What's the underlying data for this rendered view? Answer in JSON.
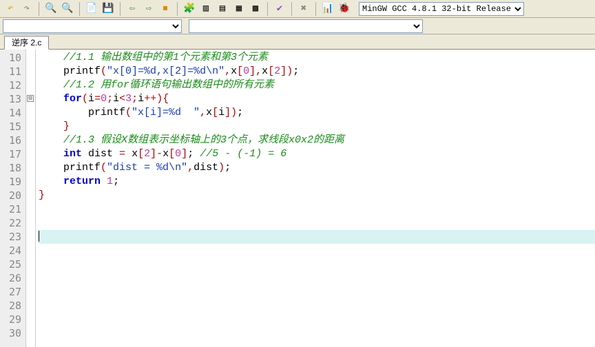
{
  "toolbar": {
    "undo_icon": "↶",
    "redo_icon": "↷",
    "search_icon": "🔍",
    "searchrep_icon": "🔍",
    "open_icon": "📄",
    "save_icon": "💾",
    "back_icon": "⇦",
    "fwd_icon": "⇨",
    "abort_icon": "⏹",
    "a_icon": "🧩",
    "b_icon": "▥",
    "c_icon": "▤",
    "d_icon": "▦",
    "e_icon": "▩",
    "check_icon": "✔",
    "x_icon": "✖",
    "chart_icon": "📊",
    "bug_icon": "🐞",
    "target_select": "MinGW GCC 4.8.1 32-bit Release"
  },
  "tab": {
    "label": "逆序 2.c"
  },
  "gutter": {
    "start": 10,
    "end": 30
  },
  "fold": {
    "line": 13,
    "glyph": "⊟"
  },
  "code": [
    {
      "indent": 4,
      "spans": [
        {
          "cls": "c-comment",
          "t": "//1.1 输出数组中的第1个元素和第3个元素"
        }
      ]
    },
    {
      "indent": 4,
      "spans": [
        {
          "cls": "c-func",
          "t": "printf"
        },
        {
          "cls": "c-op",
          "t": "("
        },
        {
          "cls": "c-str",
          "t": "\"x[0]=%d,x[2]=%d\\n\""
        },
        {
          "cls": "c-op",
          "t": ","
        },
        {
          "cls": "c-id",
          "t": "x"
        },
        {
          "cls": "c-op",
          "t": "["
        },
        {
          "cls": "c-num",
          "t": "0"
        },
        {
          "cls": "c-op",
          "t": "]"
        },
        {
          "cls": "c-op",
          "t": ","
        },
        {
          "cls": "c-id",
          "t": "x"
        },
        {
          "cls": "c-op",
          "t": "["
        },
        {
          "cls": "c-num",
          "t": "2"
        },
        {
          "cls": "c-op",
          "t": "]"
        },
        {
          "cls": "c-op",
          "t": ")"
        },
        {
          "cls": "c-punc",
          "t": ";"
        }
      ]
    },
    {
      "indent": 4,
      "spans": [
        {
          "cls": "c-comment",
          "t": "//1.2 用for循环语句输出数组中的所有元素"
        }
      ]
    },
    {
      "indent": 4,
      "spans": [
        {
          "cls": "c-kw",
          "t": "for"
        },
        {
          "cls": "c-op",
          "t": "("
        },
        {
          "cls": "c-id",
          "t": "i"
        },
        {
          "cls": "c-op",
          "t": "="
        },
        {
          "cls": "c-num",
          "t": "0"
        },
        {
          "cls": "c-op",
          "t": ";"
        },
        {
          "cls": "c-id",
          "t": "i"
        },
        {
          "cls": "c-op",
          "t": "<"
        },
        {
          "cls": "c-num",
          "t": "3"
        },
        {
          "cls": "c-op",
          "t": ";"
        },
        {
          "cls": "c-id",
          "t": "i"
        },
        {
          "cls": "c-op",
          "t": "++"
        },
        {
          "cls": "c-op",
          "t": ")"
        },
        {
          "cls": "c-op",
          "t": "{"
        }
      ]
    },
    {
      "indent": 8,
      "spans": [
        {
          "cls": "c-func",
          "t": "printf"
        },
        {
          "cls": "c-op",
          "t": "("
        },
        {
          "cls": "c-str",
          "t": "\"x[i]=%d  \""
        },
        {
          "cls": "c-op",
          "t": ","
        },
        {
          "cls": "c-id",
          "t": "x"
        },
        {
          "cls": "c-op",
          "t": "["
        },
        {
          "cls": "c-id",
          "t": "i"
        },
        {
          "cls": "c-op",
          "t": "]"
        },
        {
          "cls": "c-op",
          "t": ")"
        },
        {
          "cls": "c-punc",
          "t": ";"
        }
      ]
    },
    {
      "indent": 4,
      "spans": [
        {
          "cls": "c-op",
          "t": "}"
        }
      ]
    },
    {
      "indent": 4,
      "spans": [
        {
          "cls": "c-comment",
          "t": "//1.3 假设X数组表示坐标轴上的3个点，求线段x0x2的距离"
        }
      ]
    },
    {
      "indent": 4,
      "spans": [
        {
          "cls": "c-kw",
          "t": "int"
        },
        {
          "cls": "c-id",
          "t": " dist "
        },
        {
          "cls": "c-op",
          "t": "="
        },
        {
          "cls": "c-id",
          "t": " x"
        },
        {
          "cls": "c-op",
          "t": "["
        },
        {
          "cls": "c-num",
          "t": "2"
        },
        {
          "cls": "c-op",
          "t": "]"
        },
        {
          "cls": "c-op",
          "t": "-"
        },
        {
          "cls": "c-id",
          "t": "x"
        },
        {
          "cls": "c-op",
          "t": "["
        },
        {
          "cls": "c-num",
          "t": "0"
        },
        {
          "cls": "c-op",
          "t": "]"
        },
        {
          "cls": "c-punc",
          "t": "; "
        },
        {
          "cls": "c-comment",
          "t": "//5 - (-1) = 6"
        }
      ]
    },
    {
      "indent": 4,
      "spans": [
        {
          "cls": "c-func",
          "t": "printf"
        },
        {
          "cls": "c-op",
          "t": "("
        },
        {
          "cls": "c-str",
          "t": "\"dist = %d\\n\""
        },
        {
          "cls": "c-op",
          "t": ","
        },
        {
          "cls": "c-id",
          "t": "dist"
        },
        {
          "cls": "c-op",
          "t": ")"
        },
        {
          "cls": "c-punc",
          "t": ";"
        }
      ]
    },
    {
      "indent": 4,
      "spans": [
        {
          "cls": "c-kw",
          "t": "return"
        },
        {
          "cls": "c-id",
          "t": " "
        },
        {
          "cls": "c-num",
          "t": "1"
        },
        {
          "cls": "c-punc",
          "t": ";"
        }
      ]
    },
    {
      "indent": 0,
      "spans": [
        {
          "cls": "c-op",
          "t": "}"
        }
      ]
    },
    {
      "indent": 0,
      "spans": []
    },
    {
      "indent": 0,
      "spans": []
    },
    {
      "indent": 0,
      "current": true,
      "cursor": true,
      "spans": []
    },
    {
      "indent": 0,
      "spans": []
    },
    {
      "indent": 0,
      "spans": []
    },
    {
      "indent": 0,
      "spans": []
    },
    {
      "indent": 0,
      "spans": []
    },
    {
      "indent": 0,
      "spans": []
    },
    {
      "indent": 0,
      "spans": []
    },
    {
      "indent": 0,
      "spans": []
    }
  ]
}
